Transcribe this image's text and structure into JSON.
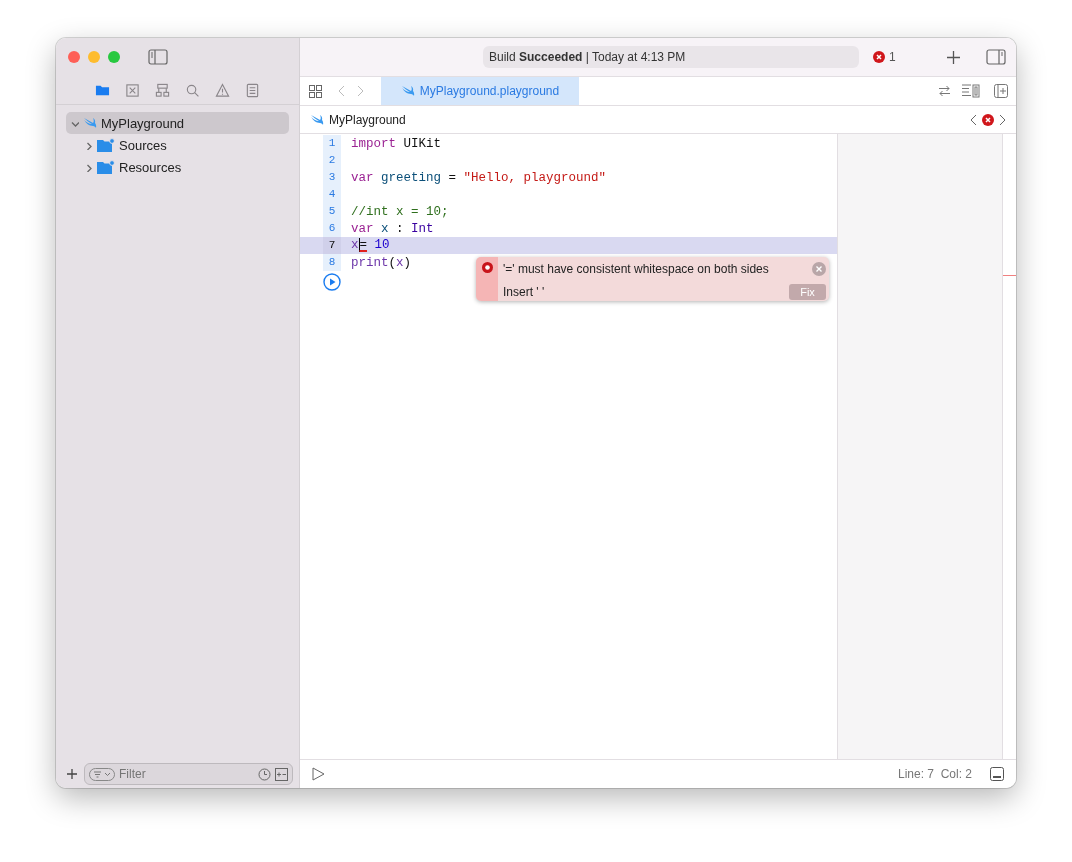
{
  "status": {
    "text": "Build **Succeeded** | Today at 4:13 PM",
    "error_count": "1"
  },
  "navigator_tabs": [
    {
      "selected": true
    },
    {
      "selected": false
    },
    {
      "selected": false
    },
    {
      "selected": false
    },
    {
      "selected": false
    },
    {
      "selected": false
    }
  ],
  "tree": [
    {
      "label": "MyPlayground",
      "kind": "playground",
      "expanded": true,
      "selected": true,
      "children": [
        {
          "label": "Sources",
          "kind": "folder",
          "expanded": false,
          "selected": false
        },
        {
          "label": "Resources",
          "kind": "folder",
          "expanded": false,
          "selected": false
        }
      ]
    }
  ],
  "filter": {
    "placeholder": "Filter"
  },
  "tabs": [
    {
      "label": "MyPlayground.playground",
      "selected": true
    }
  ],
  "jump_bar": {
    "path": "MyPlayground"
  },
  "code": [
    {
      "number": "1",
      "current": false,
      "tokens": [
        {
          "text": "import",
          "kind": "keyword"
        },
        {
          "text": " UIKit",
          "kind": "plain"
        }
      ]
    },
    {
      "number": "2",
      "current": false
    },
    {
      "number": "3",
      "current": false,
      "tokens": [
        {
          "text": "var",
          "kind": "keyword"
        },
        {
          "text": " greeting",
          "kind": "identifier"
        },
        {
          "text": " = ",
          "kind": "plain"
        },
        {
          "text": "\"Hello, playground\"",
          "kind": "string"
        }
      ]
    },
    {
      "number": "4",
      "current": false
    },
    {
      "number": "5",
      "current": false,
      "tokens": [
        {
          "text": "//int x = 10;",
          "kind": "comment"
        }
      ]
    },
    {
      "number": "6",
      "current": false,
      "tokens": [
        {
          "text": "var",
          "kind": "keyword"
        },
        {
          "text": " x",
          "kind": "identifier"
        },
        {
          "text": " : ",
          "kind": "plain"
        },
        {
          "text": "Int",
          "kind": "type"
        }
      ]
    },
    {
      "number": "7",
      "current": true,
      "tokens": [
        {
          "text": "x",
          "kind": "variable"
        },
        {
          "text": "=",
          "kind": "plain",
          "error": true,
          "caret": true
        },
        {
          "text": " 10",
          "kind": "number"
        }
      ]
    },
    {
      "number": "8",
      "current": false,
      "tokens": [
        {
          "text": "print",
          "kind": "function"
        },
        {
          "text": "(",
          "kind": "plain"
        },
        {
          "text": "x",
          "kind": "variable"
        },
        {
          "text": ")",
          "kind": "plain"
        }
      ]
    }
  ],
  "issue": {
    "message": "'=' must have consistent whitespace on both sides",
    "fixit": "Insert ' '",
    "fix_button": "Fix"
  },
  "status_bar": {
    "position": "Line: 7  Col: 2"
  }
}
